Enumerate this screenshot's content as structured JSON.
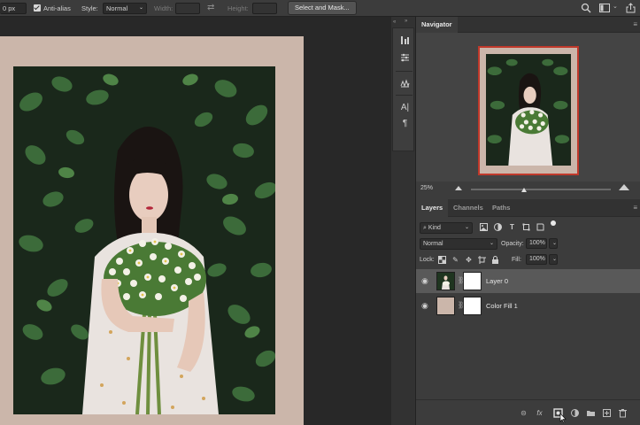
{
  "options_bar": {
    "feather_value": "0 px",
    "anti_alias_label": "Anti-alias",
    "anti_alias_checked": true,
    "style_label": "Style:",
    "style_value": "Normal",
    "width_label": "Width:",
    "height_label": "Height:",
    "select_mask_label": "Select and Mask...",
    "icons": [
      "swap-arrows-icon",
      "search-icon",
      "workspace-icon",
      "share-icon"
    ]
  },
  "navigator": {
    "tab_label": "Navigator",
    "zoom": "25%",
    "view_frame_color": "#c0392b"
  },
  "layers_panel": {
    "tabs": [
      "Layers",
      "Channels",
      "Paths"
    ],
    "active_tab": "Layers",
    "filter_kind": "Kind",
    "blend_mode": "Normal",
    "opacity_label": "Opacity:",
    "opacity_value": "100%",
    "lock_label": "Lock:",
    "fill_label": "Fill:",
    "fill_value": "100%",
    "layers": [
      {
        "name": "Layer 0",
        "visible": true,
        "selected": true
      },
      {
        "name": "Color Fill 1",
        "visible": true,
        "selected": false
      }
    ],
    "footer_icons": [
      "link-icon",
      "fx-icon",
      "mask-icon",
      "adjustment-icon",
      "folder-icon",
      "new-layer-icon",
      "trash-icon"
    ]
  },
  "colors": {
    "document_bg": "#cbb6aa",
    "panel_bg": "#3c3c3c",
    "canvas_bg": "#282828",
    "selected_layer": "#595959"
  }
}
